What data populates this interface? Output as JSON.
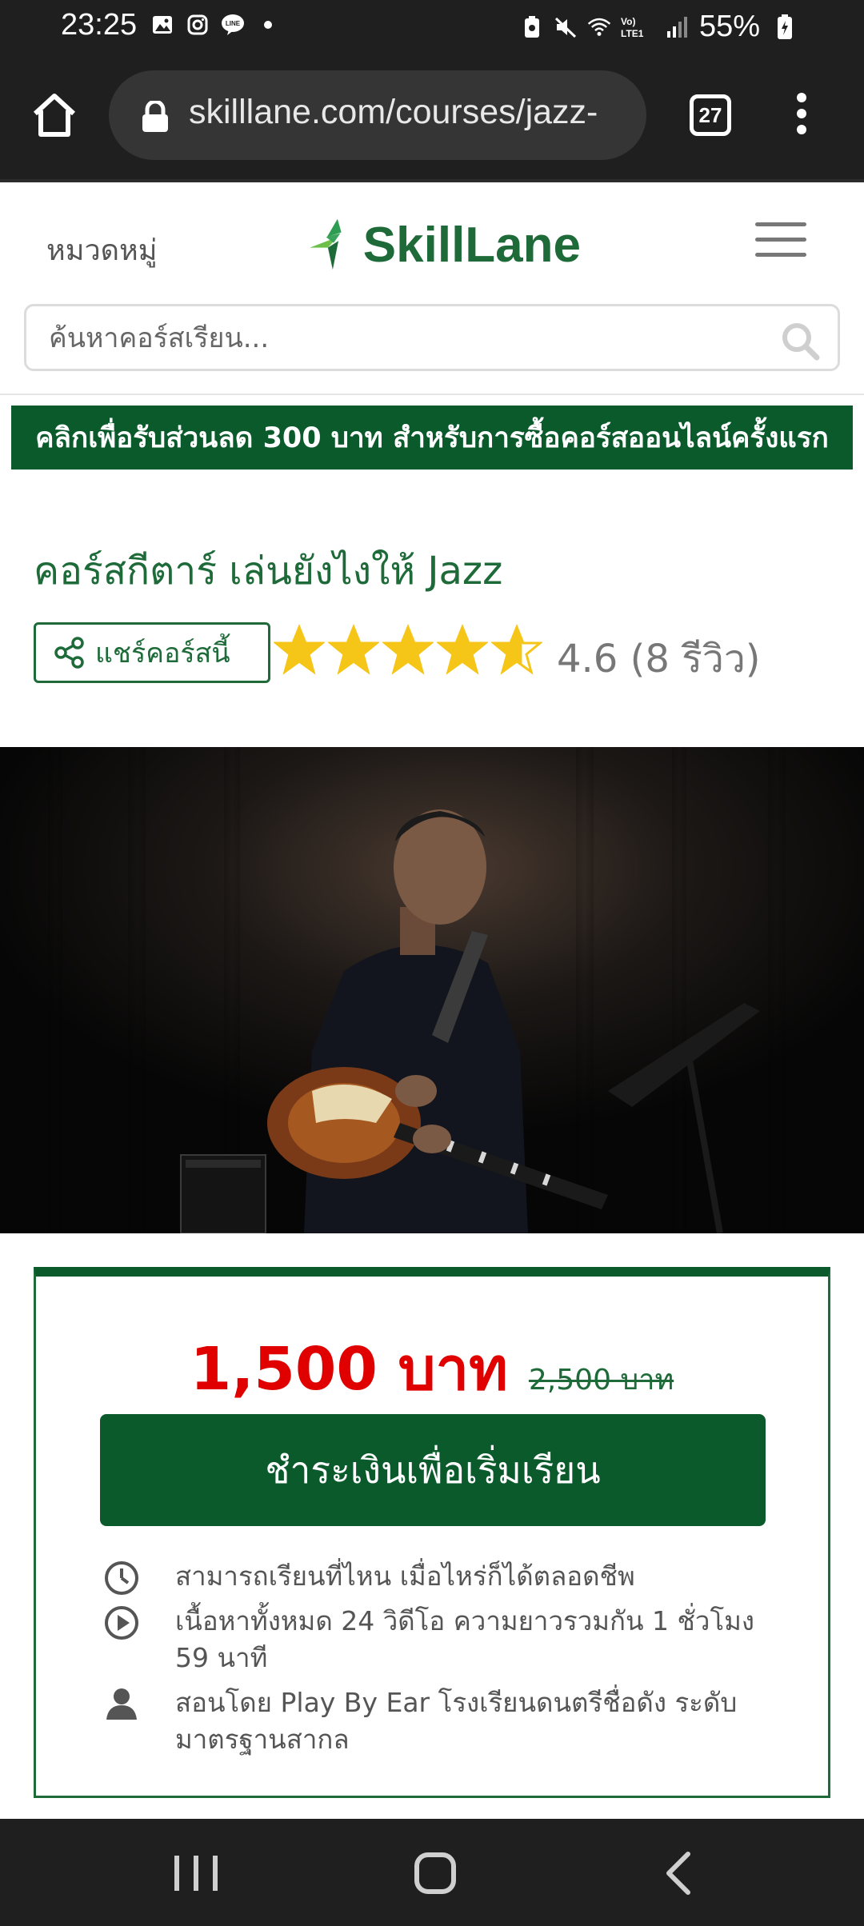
{
  "status_bar": {
    "time": "23:25",
    "battery": "55%",
    "network_label": "Vo) LTE1",
    "left_icons": [
      "gallery-icon",
      "instagram-icon",
      "line-icon",
      "dot-icon"
    ],
    "right_icons": [
      "recycle-icon",
      "mute-icon",
      "wifi-icon",
      "lte-icon",
      "signal-icon",
      "battery-icon"
    ]
  },
  "browser": {
    "url": "skilllane.com/courses/jazz-",
    "tab_count": "27"
  },
  "header": {
    "categories": "หมวดหมู่",
    "logo_text": "SkillLane",
    "search_placeholder": "ค้นหาคอร์สเรียน..."
  },
  "promo": {
    "text": "คลิกเพื่อรับส่วนลด 300 บาท สำหรับการซื้อคอร์สออนไลน์ครั้งแรก"
  },
  "course": {
    "title": "คอร์สกีตาร์ เล่นยังไงให้ Jazz",
    "share_label": "แชร์คอร์สนี้",
    "rating_value": 4.6,
    "rating_text": "4.6 (8 รีวิว)"
  },
  "price_card": {
    "price_now": "1,500 บาท",
    "price_old": "2,500 บาท",
    "buy_label": "ชำระเงินเพื่อเริ่มเรียน",
    "features": [
      {
        "icon": "clock-icon",
        "text": "สามารถเรียนที่ไหน เมื่อไหร่ก็ได้ตลอดชีพ"
      },
      {
        "icon": "play-circle-icon",
        "text": "เนื้อหาทั้งหมด 24 วิดีโอ ความยาวรวมกัน 1 ชั่วโมง 59 นาที"
      },
      {
        "icon": "user-icon",
        "text": "สอนโดย Play By Ear โรงเรียนดนตรีชื่อดัง ระดับมาตรฐานสากล"
      }
    ]
  },
  "colors": {
    "brand_green": "#1e6b39",
    "banner_green": "#0b5a2c",
    "price_red": "#e00000",
    "star_yellow": "#f5c518"
  }
}
